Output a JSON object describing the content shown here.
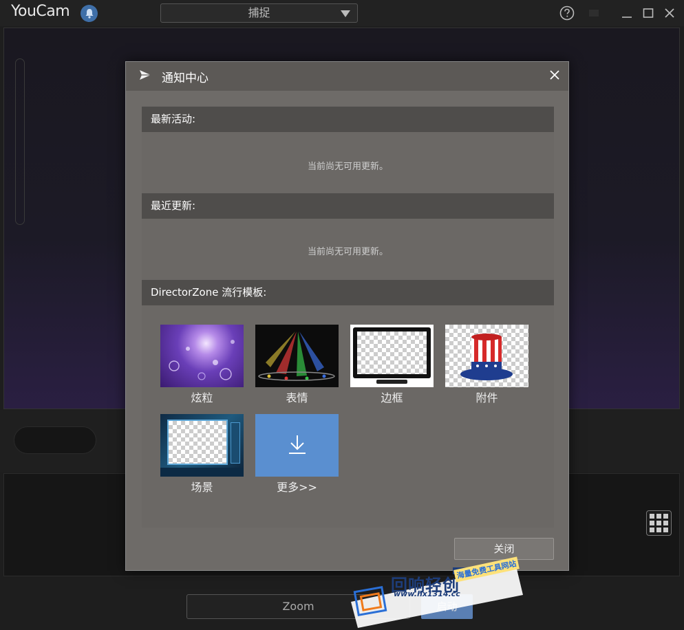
{
  "app": {
    "title": "YouCam",
    "mode_selected": "捕捉",
    "zoom_label": "Zoom",
    "start_label": "启动"
  },
  "icons": {
    "notification": "bell-icon",
    "help": "question-circle-icon",
    "minimize": "minimize-icon",
    "maximize": "maximize-icon",
    "close": "close-icon",
    "grid": "grid-icon",
    "download": "download-arrow-icon"
  },
  "dialog": {
    "title": "通知中心",
    "sections": {
      "latest_activity": {
        "heading": "最新活动:",
        "empty_text": "当前尚无可用更新。"
      },
      "recent_updates": {
        "heading": "最近更新:",
        "empty_text": "当前尚无可用更新。"
      },
      "templates": {
        "heading": "DirectorZone 流行模板:"
      }
    },
    "templates": [
      {
        "label": "炫粒"
      },
      {
        "label": "表情"
      },
      {
        "label": "边框"
      },
      {
        "label": "附件"
      },
      {
        "label": "场景"
      },
      {
        "label": "更多>>"
      }
    ],
    "close_label": "关闭"
  },
  "watermark": {
    "name": "回响轻创",
    "url": "www.hx1314.cc",
    "slogan": "海量免费工具网站"
  },
  "colors": {
    "accent_blue": "#5a8fd0",
    "dialog_bg": "#6e6b68",
    "section_header": "#4f4d4b"
  }
}
